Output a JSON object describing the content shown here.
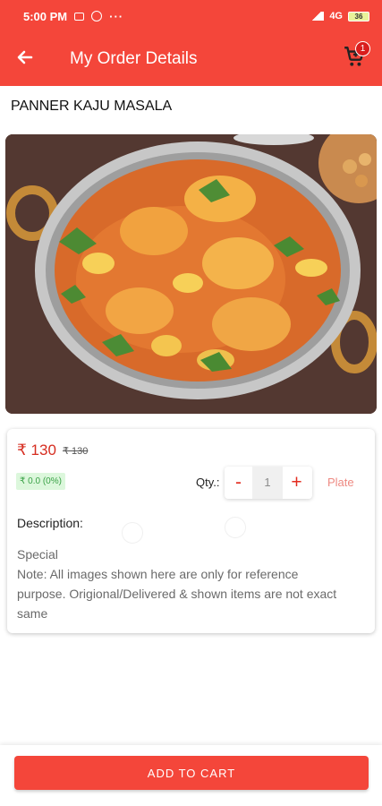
{
  "status_bar": {
    "time": "5:00 PM",
    "dots": "···",
    "network": "4G",
    "battery": "36"
  },
  "header": {
    "title": "My Order Details",
    "cart_count": "1"
  },
  "product": {
    "name": "PANNER KAJU MASALA",
    "price": "₹ 130",
    "old_price": "₹ 130",
    "discount": "₹ 0.0 (0%)",
    "qty_label": "Qty.:",
    "decrement": "-",
    "quantity": "1",
    "increment": "+",
    "unit": "Plate",
    "description_label": "Description:",
    "description_lines": [
      "Special",
      "Note: All images shown here are only for reference",
      "purpose. Origional/Delivered & shown items are not exact",
      "same"
    ]
  },
  "actions": {
    "add_to_cart": "ADD TO CART"
  },
  "colors": {
    "primary": "#f4463a",
    "price": "#d62d20",
    "discount_bg": "#dcf7dc",
    "discount_text": "#39a146"
  },
  "icons": [
    "back-arrow-icon",
    "cart-icon",
    "battery-icon",
    "signal-icon"
  ]
}
